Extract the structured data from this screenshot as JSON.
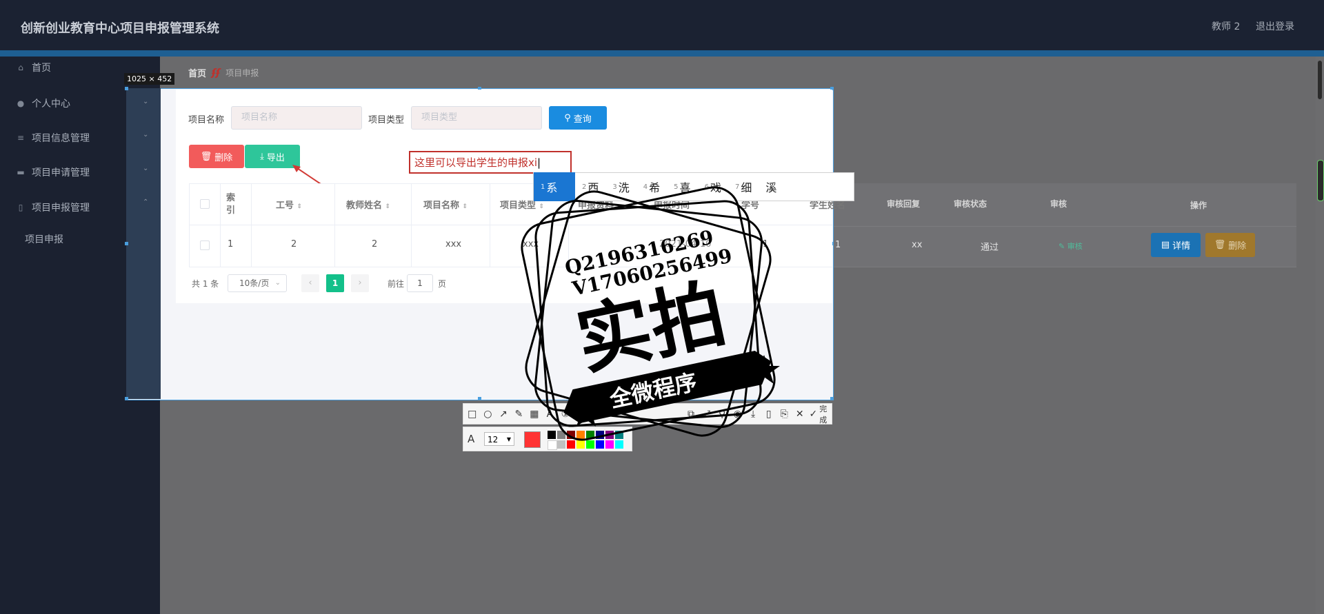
{
  "app": {
    "title": "创新创业教育中心项目申报管理系统",
    "user_label": "教师 2",
    "logout_label": "退出登录"
  },
  "sidebar": {
    "items": [
      {
        "label": "首页",
        "icon": "home-icon"
      },
      {
        "label": "个人中心",
        "icon": "user-icon"
      },
      {
        "label": "项目信息管理",
        "icon": "menu-icon"
      },
      {
        "label": "项目申请管理",
        "icon": "document-icon"
      },
      {
        "label": "项目申报管理",
        "icon": "phone-icon"
      }
    ],
    "sub_items": [
      {
        "label": "项目申报"
      }
    ]
  },
  "breadcrumb": {
    "home": "首页",
    "separator_icon": "flag-logo",
    "current": "项目申报"
  },
  "capture": {
    "size_label": "1025 × 452"
  },
  "search": {
    "name_label": "项目名称",
    "name_placeholder": "项目名称",
    "type_label": "项目类型",
    "type_placeholder": "项目类型",
    "query_label": "查询"
  },
  "actions": {
    "delete_label": "删除",
    "export_label": "导出"
  },
  "annotation_text": "这里可以导出学生的申报xi",
  "table": {
    "headers": [
      "索引",
      "工号",
      "教师姓名",
      "项目名称",
      "项目类型",
      "申报资料",
      "申报时间",
      "学号",
      "学生姓名",
      "审核回复",
      "审核状态",
      "审核",
      "操作"
    ],
    "rows": [
      {
        "index": "1",
        "staff_no": "2",
        "teacher": "2",
        "project": "xxx",
        "type": "xxx",
        "date": "2021-04-10",
        "student_no": "1",
        "student_name": "1",
        "reply": "xx",
        "status": "通过",
        "review_label": "审核",
        "detail_label": "详情",
        "delete_label": "删除"
      }
    ]
  },
  "pagination": {
    "total_label": "共 1 条",
    "page_size": "10条/页",
    "current_page": "1",
    "goto_label": "前往",
    "goto_value": "1",
    "page_suffix": "页"
  },
  "ime": {
    "candidates": [
      {
        "n": "1",
        "w": "系"
      },
      {
        "n": "2",
        "w": "西"
      },
      {
        "n": "3",
        "w": "洗"
      },
      {
        "n": "4",
        "w": "希"
      },
      {
        "n": "5",
        "w": "喜"
      },
      {
        "n": "6",
        "w": "戏"
      },
      {
        "n": "7",
        "w": "细"
      },
      {
        "n": "",
        "w": "溪"
      }
    ]
  },
  "capture_toolbar": {
    "done_label": "完成",
    "font_size": "12"
  },
  "watermark": {
    "line1": "Q2196316269",
    "line2": "V17060256499",
    "big_text": "实拍",
    "ribbon_text": "全微程序"
  },
  "colors": {
    "primary": "#1a8ce0",
    "danger": "#f25b5b",
    "success": "#2ec69a",
    "warning": "#e6a23c",
    "annotation": "#c0302b",
    "selected_color": "#ff3333"
  }
}
